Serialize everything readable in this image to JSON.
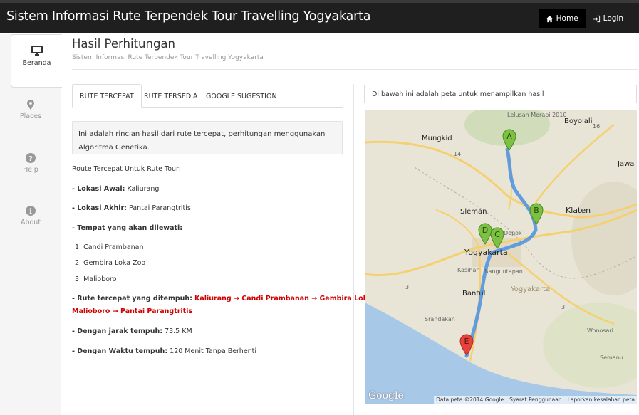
{
  "app": {
    "title": "Sistem Informasi Rute Terpendek Tour Travelling Yogyakarta"
  },
  "nav": {
    "home_label": "Home",
    "login_label": "Login",
    "home_icon": "home-icon",
    "login_icon": "login-icon"
  },
  "sidebar": {
    "items": [
      {
        "label": "Beranda",
        "icon": "desktop-icon"
      },
      {
        "label": "Places",
        "icon": "map-marker-icon"
      },
      {
        "label": "Help",
        "icon": "question-icon"
      },
      {
        "label": "About",
        "icon": "info-icon"
      }
    ]
  },
  "page": {
    "title": "Hasil Perhitungan",
    "subtitle": "Sistem Informasi Rute Terpendek Tour Travelling Yogyakarta"
  },
  "tabs": [
    "RUTE TERCEPAT",
    "RUTE TERSEDIA",
    "GOOGLE SUGESTION"
  ],
  "result": {
    "info_text": "Ini adalah rincian hasil dari rute tercepat, perhitungan menggunakan Algoritma Genetika.",
    "heading": "Route Tercepat Untuk Rute Tour:",
    "start_label": "- Lokasi Awal:",
    "start_value": "Kaliurang",
    "end_label": "- Lokasi Akhir:",
    "end_value": "Pantai Parangtritis",
    "via_label": "- Tempat yang akan dilewati:",
    "via_items": [
      "1. Candi Prambanan",
      "2. Gembira Loka Zoo",
      "3. Malioboro"
    ],
    "route_label": "- Rute tercepat yang ditempuh:",
    "route_line1": "Kaliurang → Candi Prambanan → Gembira Loka Zoo →",
    "route_line2": "Malioboro → Pantai Parangtritis",
    "distance_label": "- Dengan jarak tempuh:",
    "distance_value": "73.5 KM",
    "time_label": "- Dengan Waktu tempuh:",
    "time_value": "120 Menit Tanpa Berhenti"
  },
  "map": {
    "header": "Di bawah ini adalah peta untuk menampilkan hasil",
    "labels": {
      "merapi": "Lelusan Merapi 2010",
      "boyolali": "Boyolali",
      "mungkid": "Mungkid",
      "jawa": "Jawa",
      "sleman": "Sleman",
      "klaten": "Klaten",
      "depok": "Depok",
      "yogyakarta": "Yogyakarta",
      "kasihan": "Kasihan",
      "banguntapan": "Banguntapan",
      "bantul": "Bantul",
      "yogyakarta_region": "Yogyakarta",
      "srandakan": "Srandakan",
      "wonosari": "Wonosari",
      "semanu": "Semanu",
      "road_16": "16",
      "road_14": "14",
      "road_3a": "3",
      "road_3b": "3"
    },
    "markers": [
      "A",
      "B",
      "C",
      "D",
      "E"
    ],
    "logo": "Google",
    "footer": [
      "Data peta ©2014 Google",
      "Syarat Penggunaan",
      "Laporkan kesalahan peta"
    ],
    "colors": {
      "route": "#4a90e2",
      "marker_green": "#7cc142",
      "marker_red": "#e8423c",
      "sea": "#a8c8e8"
    }
  }
}
